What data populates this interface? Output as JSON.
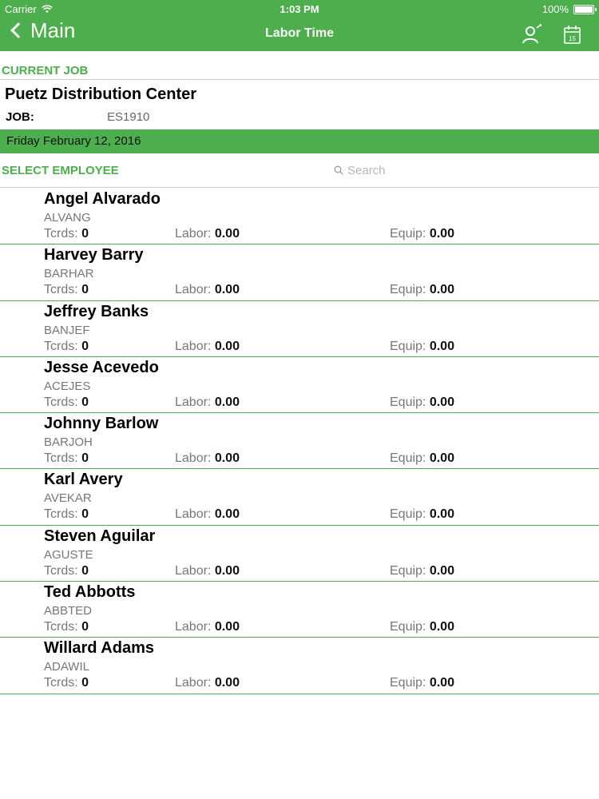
{
  "status_bar": {
    "carrier": "Carrier",
    "time": "1:03 PM",
    "battery": "100%"
  },
  "nav": {
    "back_label": "Main",
    "title": "Labor Time"
  },
  "current_job": {
    "section_label": "CURRENT JOB",
    "name": "Puetz Distribution Center",
    "job_key": "JOB:",
    "job_value": "ES1910"
  },
  "date": "Friday February 12, 2016",
  "select_employee": {
    "label": "SELECT EMPLOYEE",
    "search_placeholder": "Search"
  },
  "calendar_day": "15",
  "labels": {
    "tcrds": "Tcrds:",
    "labor": "Labor:",
    "equip": "Equip:"
  },
  "colors": {
    "accent": "#4cae4c"
  },
  "employees": [
    {
      "name": "Angel Alvarado",
      "code": "ALVANG",
      "tcrds": "0",
      "labor": "0.00",
      "equip": "0.00"
    },
    {
      "name": "Harvey Barry",
      "code": "BARHAR",
      "tcrds": "0",
      "labor": "0.00",
      "equip": "0.00"
    },
    {
      "name": "Jeffrey Banks",
      "code": "BANJEF",
      "tcrds": "0",
      "labor": "0.00",
      "equip": "0.00"
    },
    {
      "name": "Jesse Acevedo",
      "code": "ACEJES",
      "tcrds": "0",
      "labor": "0.00",
      "equip": "0.00"
    },
    {
      "name": "Johnny Barlow",
      "code": "BARJOH",
      "tcrds": "0",
      "labor": "0.00",
      "equip": "0.00"
    },
    {
      "name": "Karl Avery",
      "code": "AVEKAR",
      "tcrds": "0",
      "labor": "0.00",
      "equip": "0.00"
    },
    {
      "name": "Steven Aguilar",
      "code": "AGUSTE",
      "tcrds": "0",
      "labor": "0.00",
      "equip": "0.00"
    },
    {
      "name": "Ted Abbotts",
      "code": "ABBTED",
      "tcrds": "0",
      "labor": "0.00",
      "equip": "0.00"
    },
    {
      "name": "Willard Adams",
      "code": "ADAWIL",
      "tcrds": "0",
      "labor": "0.00",
      "equip": "0.00"
    }
  ]
}
